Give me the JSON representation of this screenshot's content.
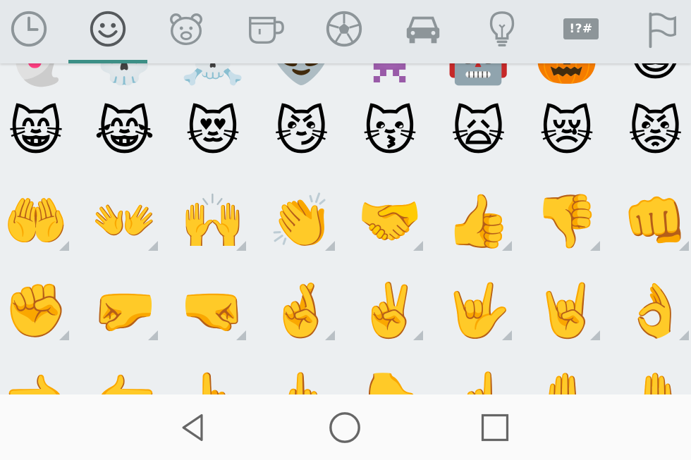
{
  "tabs": [
    {
      "id": "recent",
      "icon": "clock-icon"
    },
    {
      "id": "smileys",
      "icon": "smiley-icon",
      "selected": true
    },
    {
      "id": "animals",
      "icon": "bear-icon"
    },
    {
      "id": "food",
      "icon": "coffee-cup-icon"
    },
    {
      "id": "activity",
      "icon": "soccer-ball-icon"
    },
    {
      "id": "travel",
      "icon": "car-icon"
    },
    {
      "id": "objects",
      "icon": "lightbulb-icon"
    },
    {
      "id": "symbols",
      "icon": "symbols-icon",
      "label": "!?#"
    },
    {
      "id": "flags",
      "icon": "flag-icon"
    }
  ],
  "emoji_rows": [
    [
      "👻",
      "💀",
      "☠️",
      "👽",
      "👾",
      "🤖",
      "🎃",
      "😺"
    ],
    [
      "😸",
      "😹",
      "😻",
      "😼",
      "😽",
      "🙀",
      "😿",
      "😾"
    ],
    [
      "🤲",
      "👐",
      "🙌",
      "👏",
      "🤝",
      "👍",
      "👎",
      "👊"
    ],
    [
      "✊",
      "🤛",
      "🤜",
      "🤞",
      "✌️",
      "🤟",
      "🤘",
      "👌"
    ],
    [
      "👈",
      "👉",
      "👆",
      "🖕",
      "👇",
      "☝️",
      "✋",
      "🤚"
    ]
  ],
  "skin_tone_rows": [
    2,
    3
  ],
  "nav": [
    "back-icon",
    "home-icon",
    "recents-icon"
  ],
  "colors": {
    "accent": "#3c8f86",
    "icon_gray": "#8d9599"
  }
}
